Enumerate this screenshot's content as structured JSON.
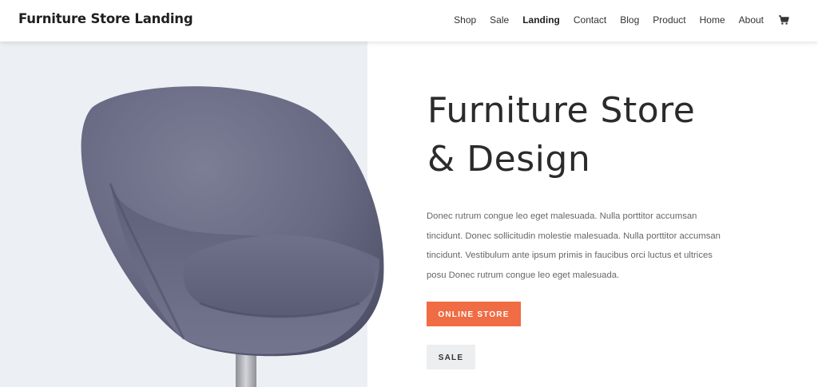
{
  "header": {
    "brand": "Furniture Store Landing",
    "nav": [
      "Shop",
      "Sale",
      "Landing",
      "Contact",
      "Blog",
      "Product",
      "Home",
      "About"
    ],
    "active_nav": "Landing",
    "cart_icon": "cart-icon"
  },
  "hero": {
    "headline_line1": "Furniture Store",
    "headline_line2": "& Design",
    "body": "Donec rutrum congue leo eget malesuada. Nulla porttitor accumsan tincidunt. Donec sollicitudin molestie malesuada. Nulla porttitor accumsan tincidunt. Vestibulum ante ipsum primis in faucibus orci luctus et ultrices posu Donec rutrum congue leo eget malesuada.",
    "primary_button": "ONLINE STORE",
    "secondary_button": "SALE"
  },
  "colors": {
    "accent": "#ef6c44",
    "left_panel_bg": "#eceff3",
    "secondary_button_bg": "#eceef0"
  }
}
